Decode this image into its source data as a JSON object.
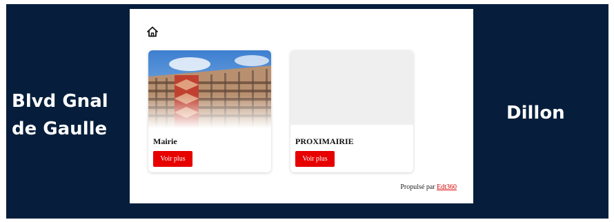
{
  "left_label": "Blvd Gnal\nde Gaulle",
  "right_label": "Dillon",
  "header": {
    "home_icon": "home-icon"
  },
  "cards": [
    {
      "title": "Mairie",
      "button_label": "Voir plus",
      "image": "building-photo"
    },
    {
      "title": "PROXIMAIRIE",
      "button_label": "Voir plus",
      "image": "placeholder"
    }
  ],
  "footer": {
    "prefix": "Propulsé par",
    "link_text": "Edt360"
  },
  "colors": {
    "background": "#061e3c",
    "button": "#e60000",
    "link": "#d40000"
  }
}
